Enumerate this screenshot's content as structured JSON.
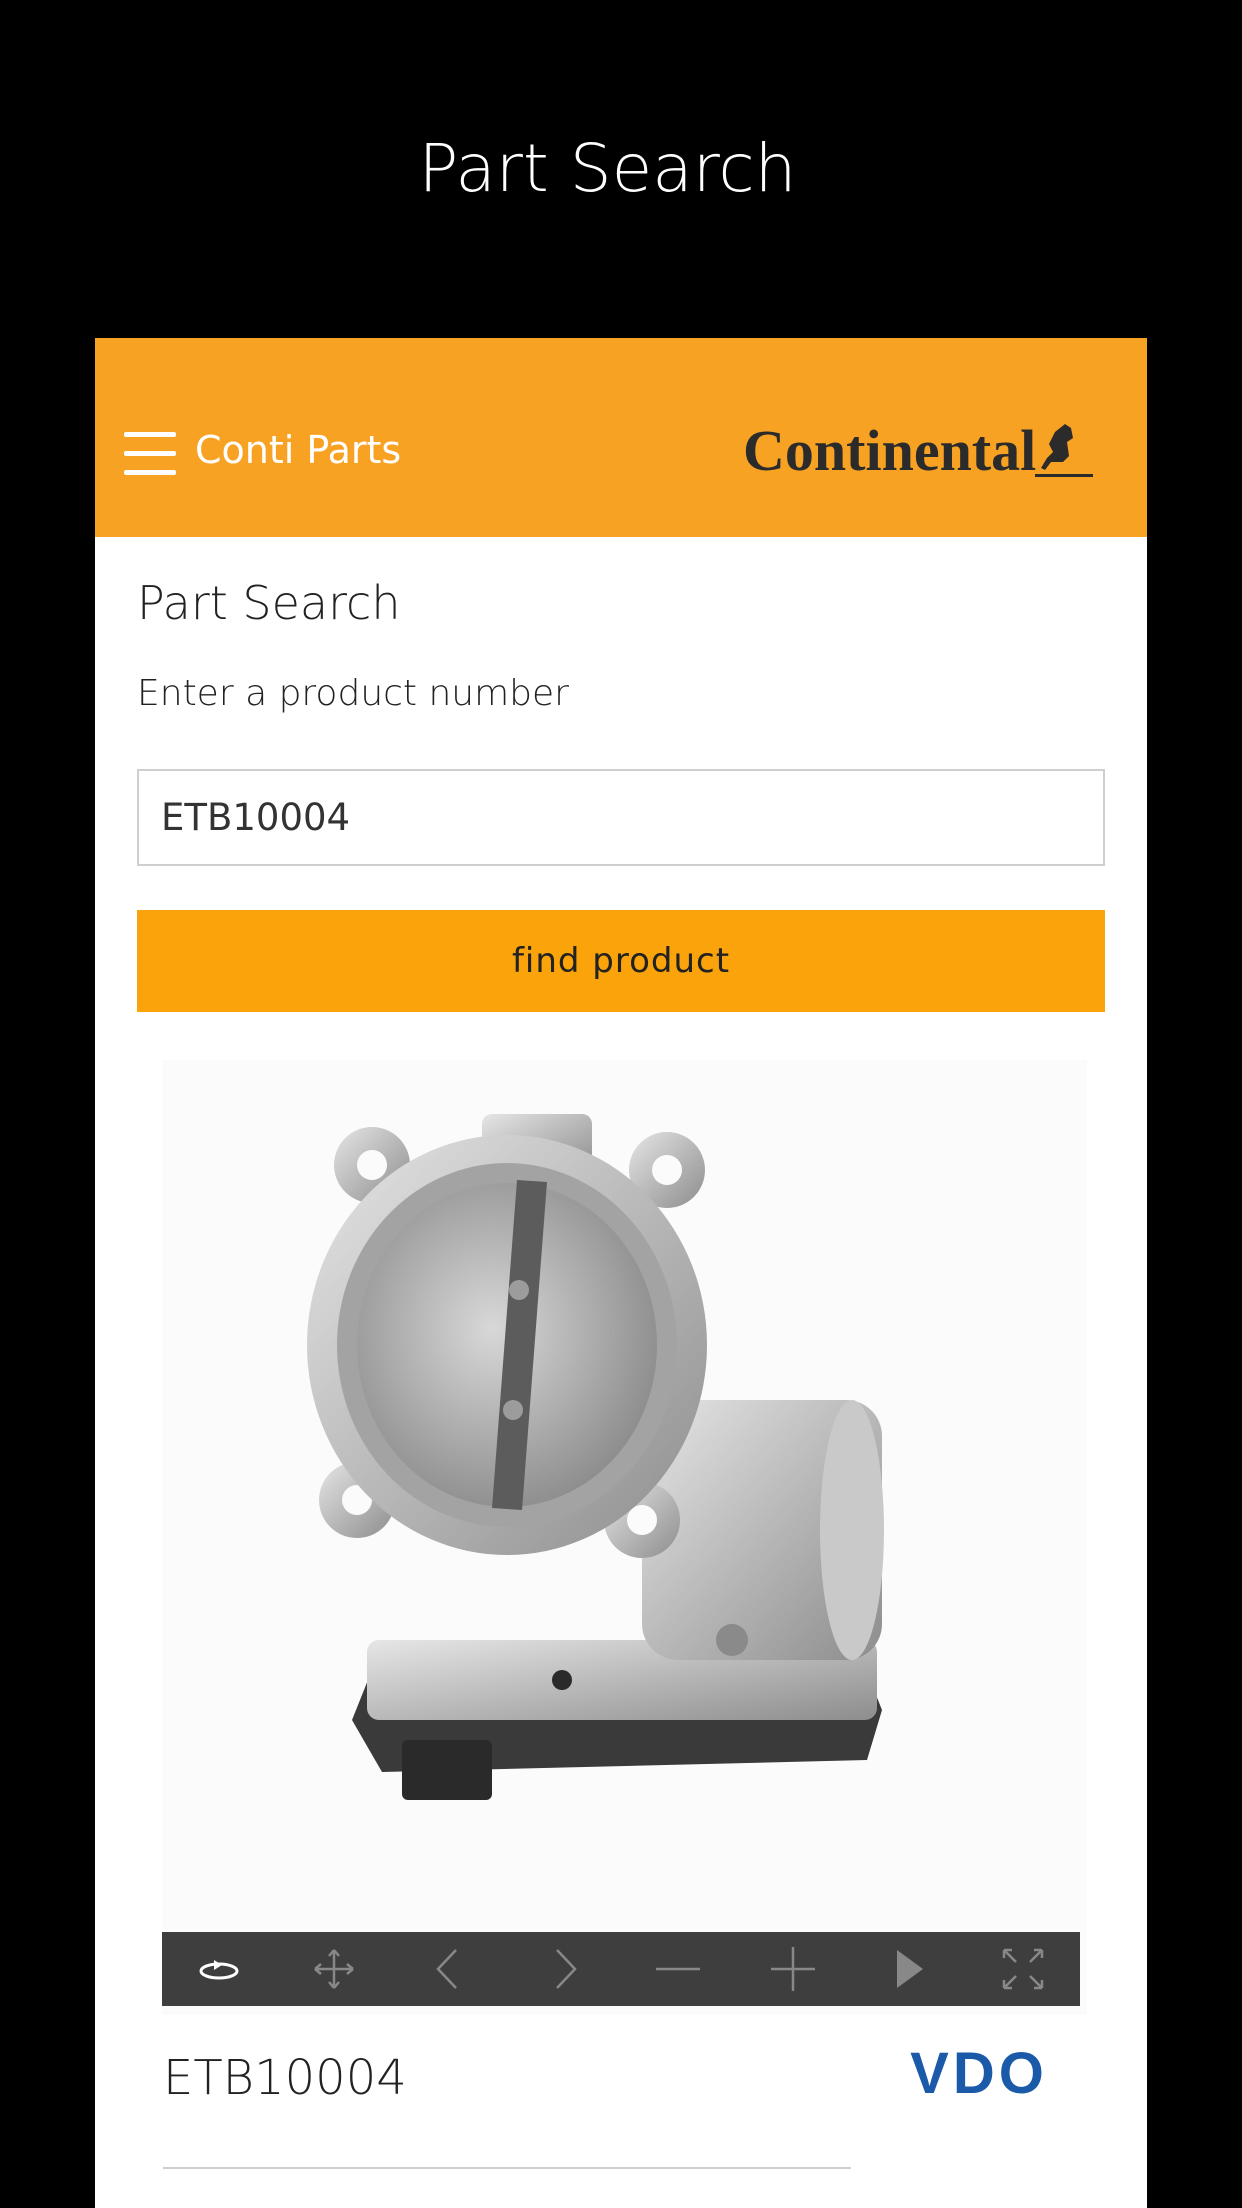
{
  "screen": {
    "title": "Part Search"
  },
  "app_bar": {
    "app_name": "Conti Parts",
    "brand": "Continental",
    "background": "#f8a224"
  },
  "search": {
    "heading": "Part Search",
    "hint": "Enter a product number",
    "input_value": "ETB10004",
    "button_label": "find product",
    "button_color": "#fba30a"
  },
  "viewer": {
    "toolbar_icons": [
      "rotate-icon",
      "pan-icon",
      "chevron-left-icon",
      "chevron-right-icon",
      "zoom-out-icon",
      "zoom-in-icon",
      "play-icon",
      "fullscreen-icon"
    ]
  },
  "product": {
    "part_number": "ETB10004",
    "brand_logo": "VDO",
    "brand_color": "#1a5aa8"
  }
}
